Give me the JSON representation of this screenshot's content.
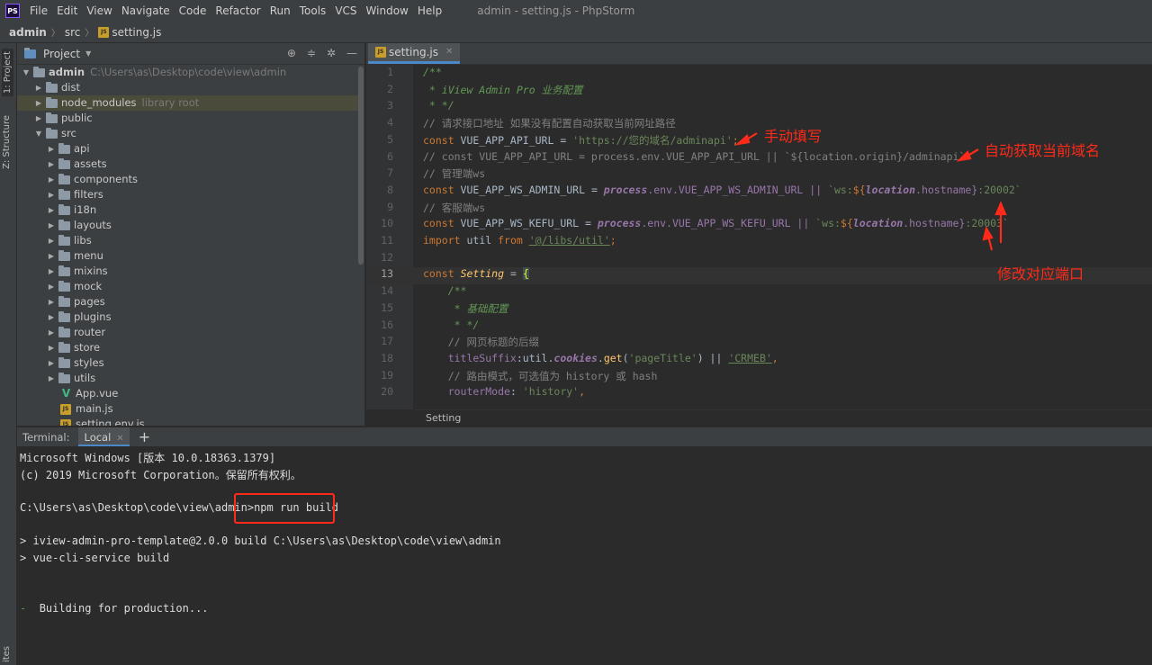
{
  "menubar": {
    "logo": "PS",
    "items": [
      "File",
      "Edit",
      "View",
      "Navigate",
      "Code",
      "Refactor",
      "Run",
      "Tools",
      "VCS",
      "Window",
      "Help"
    ],
    "window_title": "admin - setting.js - PhpStorm"
  },
  "breadcrumb": {
    "root": "admin",
    "folder": "src",
    "file": "setting.js"
  },
  "toolstrip": {
    "project": "1: Project",
    "structure": "Z: Structure",
    "bottom": "ites"
  },
  "project_panel": {
    "title": "Project",
    "root_name": "admin",
    "root_path": "C:\\Users\\as\\Desktop\\code\\view\\admin",
    "top_items": [
      {
        "name": "dist",
        "hint": ""
      },
      {
        "name": "node_modules",
        "hint": "library root"
      },
      {
        "name": "public",
        "hint": ""
      },
      {
        "name": "src",
        "hint": ""
      }
    ],
    "src_children": [
      "api",
      "assets",
      "components",
      "filters",
      "i18n",
      "layouts",
      "libs",
      "menu",
      "mixins",
      "mock",
      "pages",
      "plugins",
      "router",
      "store",
      "styles",
      "utils"
    ],
    "src_files": [
      "App.vue",
      "main.js",
      "setting.env.js"
    ]
  },
  "editor": {
    "tab": "setting.js",
    "footer": "Setting",
    "line_numbers": [
      "1",
      "2",
      "3",
      "4",
      "5",
      "6",
      "7",
      "8",
      "9",
      "10",
      "11",
      "12",
      "13",
      "14",
      "15",
      "16",
      "17",
      "18",
      "19",
      "20"
    ],
    "code": {
      "l1": "/**",
      "l2": " * iView Admin Pro 业务配置",
      "l3": " * */",
      "l4": "// 请求接口地址 如果没有配置自动获取当前网址路径",
      "l5_kw": "const",
      "l5_name": " VUE_APP_API_URL = ",
      "l5_str": "'https://您的域名/adminapi'",
      "l5_end": ";",
      "l6": "// const VUE_APP_API_URL = process.env.VUE_APP_API_URL || `${location.origin}/adminapi`",
      "l7": "// 管理端ws",
      "l8_kw": "const",
      "l8_name": " VUE_APP_WS_ADMIN_URL = ",
      "l8_process": "process",
      "l8_env": ".env.VUE_APP_WS_ADMIN_URL || ",
      "l8_str1": "`ws:",
      "l8_tpl": "${",
      "l8_loc": "location",
      "l8_host": ".hostname}",
      "l8_str2": ":20002`",
      "l9": "// 客服端ws",
      "l10_kw": "const",
      "l10_name": " VUE_APP_WS_KEFU_URL = ",
      "l10_process": "process",
      "l10_env": ".env.VUE_APP_WS_KEFU_URL || ",
      "l10_str1": "`ws:",
      "l10_tpl": "${",
      "l10_loc": "location",
      "l10_host": ".hostname}",
      "l10_str2": ":20003`",
      "l11_kw1": "import",
      "l11_name": " util ",
      "l11_kw2": "from",
      "l11_str": "'@/libs/util'",
      "l11_end": ";",
      "l13_kw": "const",
      "l13_name": "Setting",
      "l13_eq": " = ",
      "l13_brace": "{",
      "l14": "    /**",
      "l15": "     * 基础配置",
      "l16": "     * */",
      "l17": "    // 网页标题的后缀",
      "l18_prop": "    titleSuffix",
      "l18_colon": ":util.",
      "l18_cookies": "cookies",
      "l18_dot": ".",
      "l18_get": "get",
      "l18_open": "(",
      "l18_arg": "'pageTitle'",
      "l18_or": ") || ",
      "l18_str": "'CRMEB'",
      "l18_end": ",",
      "l19": "    // 路由模式，可选值为 history 或 hash",
      "l20_prop": "    routerMode",
      "l20_colon": ": ",
      "l20_str": "'history'",
      "l20_end": ","
    }
  },
  "annotations": {
    "manual": "手动填写",
    "auto": "自动获取当前域名",
    "port": "修改对应端口"
  },
  "terminal": {
    "label": "Terminal:",
    "tab": "Local",
    "lines": [
      "Microsoft Windows [版本 10.0.18363.1379]",
      "(c) 2019 Microsoft Corporation。保留所有权利。",
      "C:\\Users\\as\\Desktop\\code\\view\\admin>npm run build",
      "> iview-admin-pro-template@2.0.0 build C:\\Users\\as\\Desktop\\code\\view\\admin",
      "> vue-cli-service build",
      "Building for production..."
    ],
    "spinner": "-"
  },
  "colors": {
    "accent": "#4a88c7",
    "annotation": "#ff2a1a",
    "keyword": "#cc7832",
    "string": "#6a8759"
  }
}
